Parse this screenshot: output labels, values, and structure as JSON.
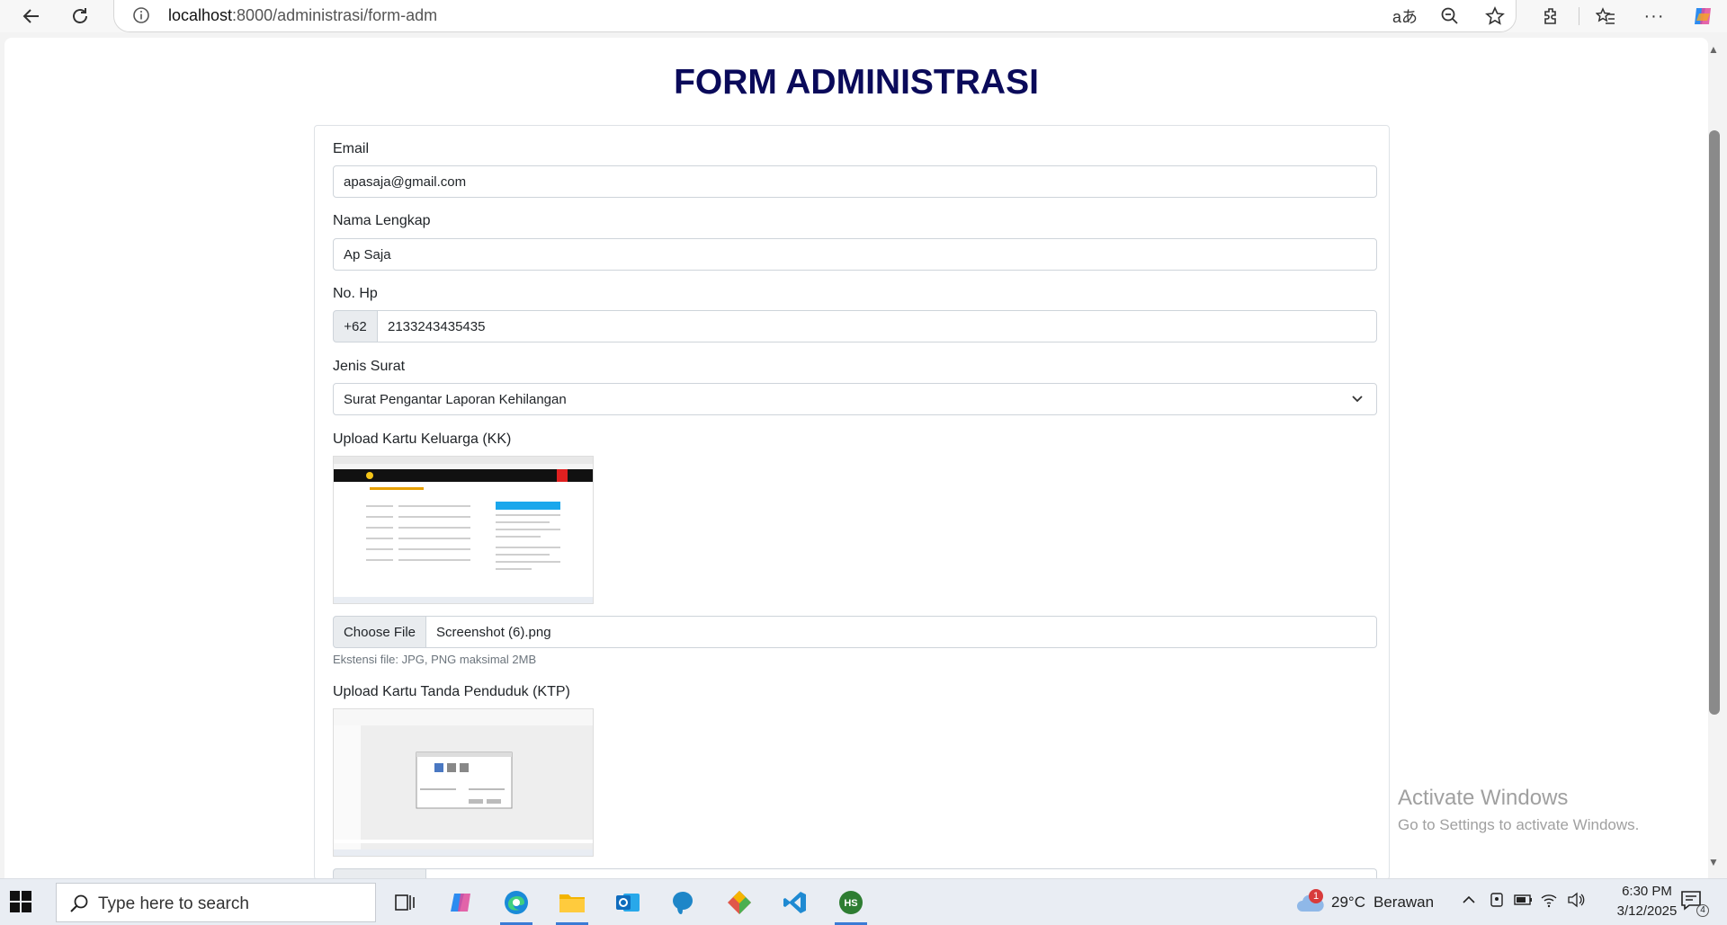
{
  "browser": {
    "url_host": "localhost",
    "url_path": ":8000/administrasi/form-adm"
  },
  "page": {
    "title": "FORM ADMINISTRASI"
  },
  "form": {
    "email": {
      "label": "Email",
      "value": "apasaja@gmail.com"
    },
    "nama": {
      "label": "Nama Lengkap",
      "value": "Ap Saja"
    },
    "hp": {
      "label": "No. Hp",
      "prefix": "+62",
      "value": "2133243435435"
    },
    "jenis_surat": {
      "label": "Jenis Surat",
      "value": "Surat Pengantar Laporan Kehilangan"
    },
    "kk": {
      "label": "Upload Kartu Keluarga (KK)",
      "button": "Choose File",
      "file_name": "Screenshot (6).png",
      "hint": "Ekstensi file: JPG, PNG maksimal 2MB"
    },
    "ktp": {
      "label": "Upload Kartu Tanda Penduduk (KTP)"
    }
  },
  "watermark": {
    "line1": "Activate Windows",
    "line2": "Go to Settings to activate Windows."
  },
  "taskbar": {
    "search_placeholder": "Type here to search",
    "weather_temp": "29°C",
    "weather_text": "Berawan",
    "weather_badge": "1",
    "time": "6:30 PM",
    "date": "3/12/2025",
    "notification_count": "4"
  }
}
